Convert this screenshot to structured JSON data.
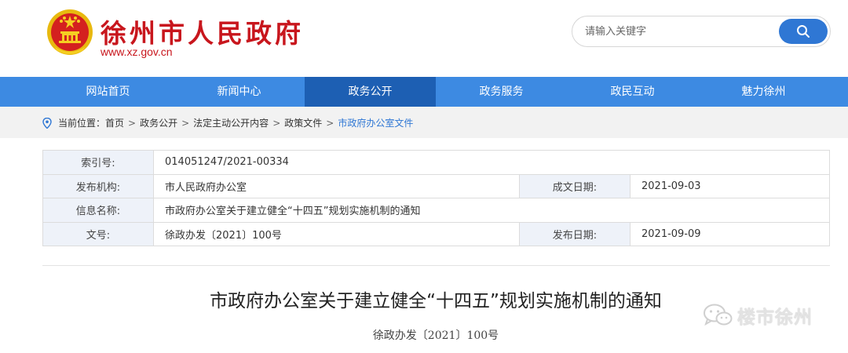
{
  "header": {
    "site_title": "徐州市人民政府",
    "site_url": "www.xz.gov.cn",
    "search_placeholder": "请输入关键字",
    "search_icon": "search-icon",
    "emblem_icon": "national-emblem-icon"
  },
  "colors": {
    "brand_red": "#c8161d",
    "nav_blue": "#3d8ae2",
    "nav_active": "#1d5fb3",
    "link_blue": "#2f77d4"
  },
  "nav": {
    "items": [
      {
        "label": "网站首页"
      },
      {
        "label": "新闻中心"
      },
      {
        "label": "政务公开",
        "active": true
      },
      {
        "label": "政务服务"
      },
      {
        "label": "政民互动"
      },
      {
        "label": "魅力徐州"
      }
    ]
  },
  "breadcrumb": {
    "prefix": "当前位置：",
    "items": [
      "首页",
      "政务公开",
      "法定主动公开内容",
      "政策文件",
      "市政府办公室文件"
    ],
    "separator": ">"
  },
  "info": {
    "index_label": "索引号:",
    "index_value": "014051247/2021-00334",
    "publisher_label": "发布机构:",
    "publisher_value": "市人民政府办公室",
    "created_label": "成文日期:",
    "created_value": "2021-09-03",
    "name_label": "信息名称:",
    "name_value": "市政府办公室关于建立健全“十四五”规划实施机制的通知",
    "docno_label": "文号:",
    "docno_value": "徐政办发〔2021〕100号",
    "published_label": "发布日期:",
    "published_value": "2021-09-09"
  },
  "article": {
    "title": "市政府办公室关于建立健全“十四五”规划实施机制的通知",
    "doc_no": "徐政办发〔2021〕100号"
  },
  "watermark": {
    "text": "楼市徐州",
    "icon": "wechat-icon"
  }
}
